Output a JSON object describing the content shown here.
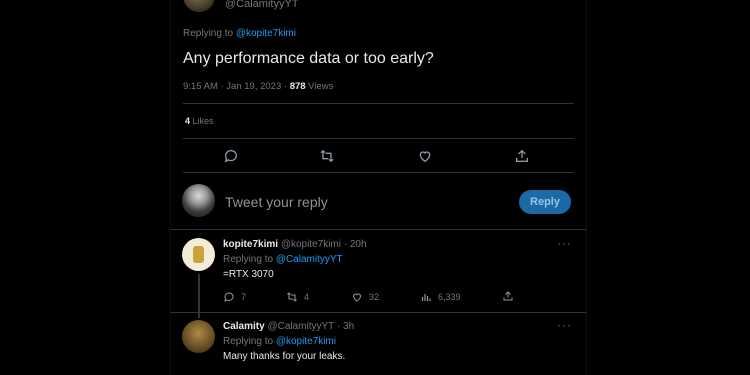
{
  "top_tweet": {
    "handle": "@CalamityyYT",
    "replying_prefix": "Replying to ",
    "replying_to": "@kopite7kimi",
    "text": "Any performance data or too early?",
    "time": "9:15 AM · Jan 19, 2023 · ",
    "views_count": "878",
    "views_label": " Views",
    "likes_count": "4",
    "likes_label": " Likes"
  },
  "composer": {
    "placeholder": "Tweet your reply",
    "reply_label": "Reply"
  },
  "replies": [
    {
      "name": "kopite7kimi",
      "meta": "@kopite7kimi · 20h",
      "replying_prefix": "Replying to ",
      "replying_to": "@CalamityyYT",
      "text": "=RTX 3070",
      "replies": "7",
      "retweets": "4",
      "likes": "32",
      "views": "6,339"
    },
    {
      "name": "Calamity",
      "meta": "@CalamityyYT · 3h",
      "replying_prefix": "Replying to ",
      "replying_to": "@kopite7kimi",
      "text": "Many thanks for your leaks."
    }
  ],
  "colors": {
    "accent": "#1d9bf0",
    "muted": "#71767b",
    "background": "#000000"
  }
}
